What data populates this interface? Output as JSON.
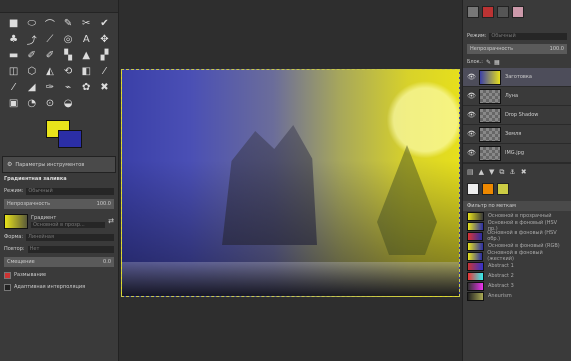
{
  "left_panel": {
    "tools": [
      "■",
      "⬭",
      "⌒",
      "✎",
      "✂",
      "✔",
      "♣",
      "⤴",
      "⟋",
      "◎",
      "A",
      "✥",
      "▬",
      "✐",
      "✐",
      "▚",
      "▲",
      "▞",
      "◫",
      "⬡",
      "◭",
      "⟲",
      "◧",
      "⁄",
      "⁄",
      "◢",
      "✑",
      "⌁",
      "✿",
      "✖",
      "▣",
      "◔",
      "⊙",
      "◒"
    ],
    "tab_label": "Параметры инструментов",
    "options_title": "Градиентная заливка",
    "mode_label": "Режим:",
    "mode_value": "Обычный",
    "opacity_label": "Непрозрачность",
    "opacity_value": "100.0",
    "gradient_label": "Градиент",
    "gradient_value": "Основной в прозр...",
    "shape_label": "Форма:",
    "shape_value": "Линейная",
    "repeat_label": "Повтор:",
    "repeat_value": "Нет",
    "offset_label": "Смещение",
    "offset_value": "0.0",
    "dither_label": "Размывание",
    "adaptive_label": "Адаптивная интерполяция"
  },
  "right_panel": {
    "mode_label": "Режим:",
    "mode_value": "Обычный",
    "opacity_label": "Непрозрачность",
    "opacity_value": "100.0",
    "lock_label": "Блок.:",
    "layers": [
      {
        "name": "Заготовка",
        "active": true
      },
      {
        "name": "Луна",
        "active": false
      },
      {
        "name": "Drop Shadow",
        "active": false
      },
      {
        "name": "Земля",
        "active": false
      },
      {
        "name": "IMG.jpg",
        "active": false
      }
    ],
    "gradients_title": "Фильтр по меткам",
    "gradients": [
      {
        "name": "Основной в прозрачный",
        "colors": [
          "#e8e31b",
          "#3a3a3a"
        ]
      },
      {
        "name": "Основной в фоновый (HSV пр.)",
        "colors": [
          "#e8e31b",
          "#2b2ea6"
        ]
      },
      {
        "name": "Основной в фоновый (HSV обр.)",
        "colors": [
          "#d33",
          "#2b2ea6"
        ]
      },
      {
        "name": "Основной в фоновый (RGB)",
        "colors": [
          "#e8e31b",
          "#2b2ea6"
        ]
      },
      {
        "name": "Основной в фоновый (жесткий)",
        "colors": [
          "#e8e31b",
          "#2b2ea6"
        ]
      },
      {
        "name": "Abstract 1",
        "colors": [
          "#c33",
          "#33c"
        ]
      },
      {
        "name": "Abstract 2",
        "colors": [
          "#e33",
          "#3ee"
        ]
      },
      {
        "name": "Abstract 3",
        "colors": [
          "#333",
          "#e3e"
        ]
      },
      {
        "name": "Aneurism",
        "colors": [
          "#222",
          "#aa5"
        ]
      }
    ]
  },
  "colors": {
    "foreground": "#e8e31b",
    "background": "#2b2ea6"
  }
}
